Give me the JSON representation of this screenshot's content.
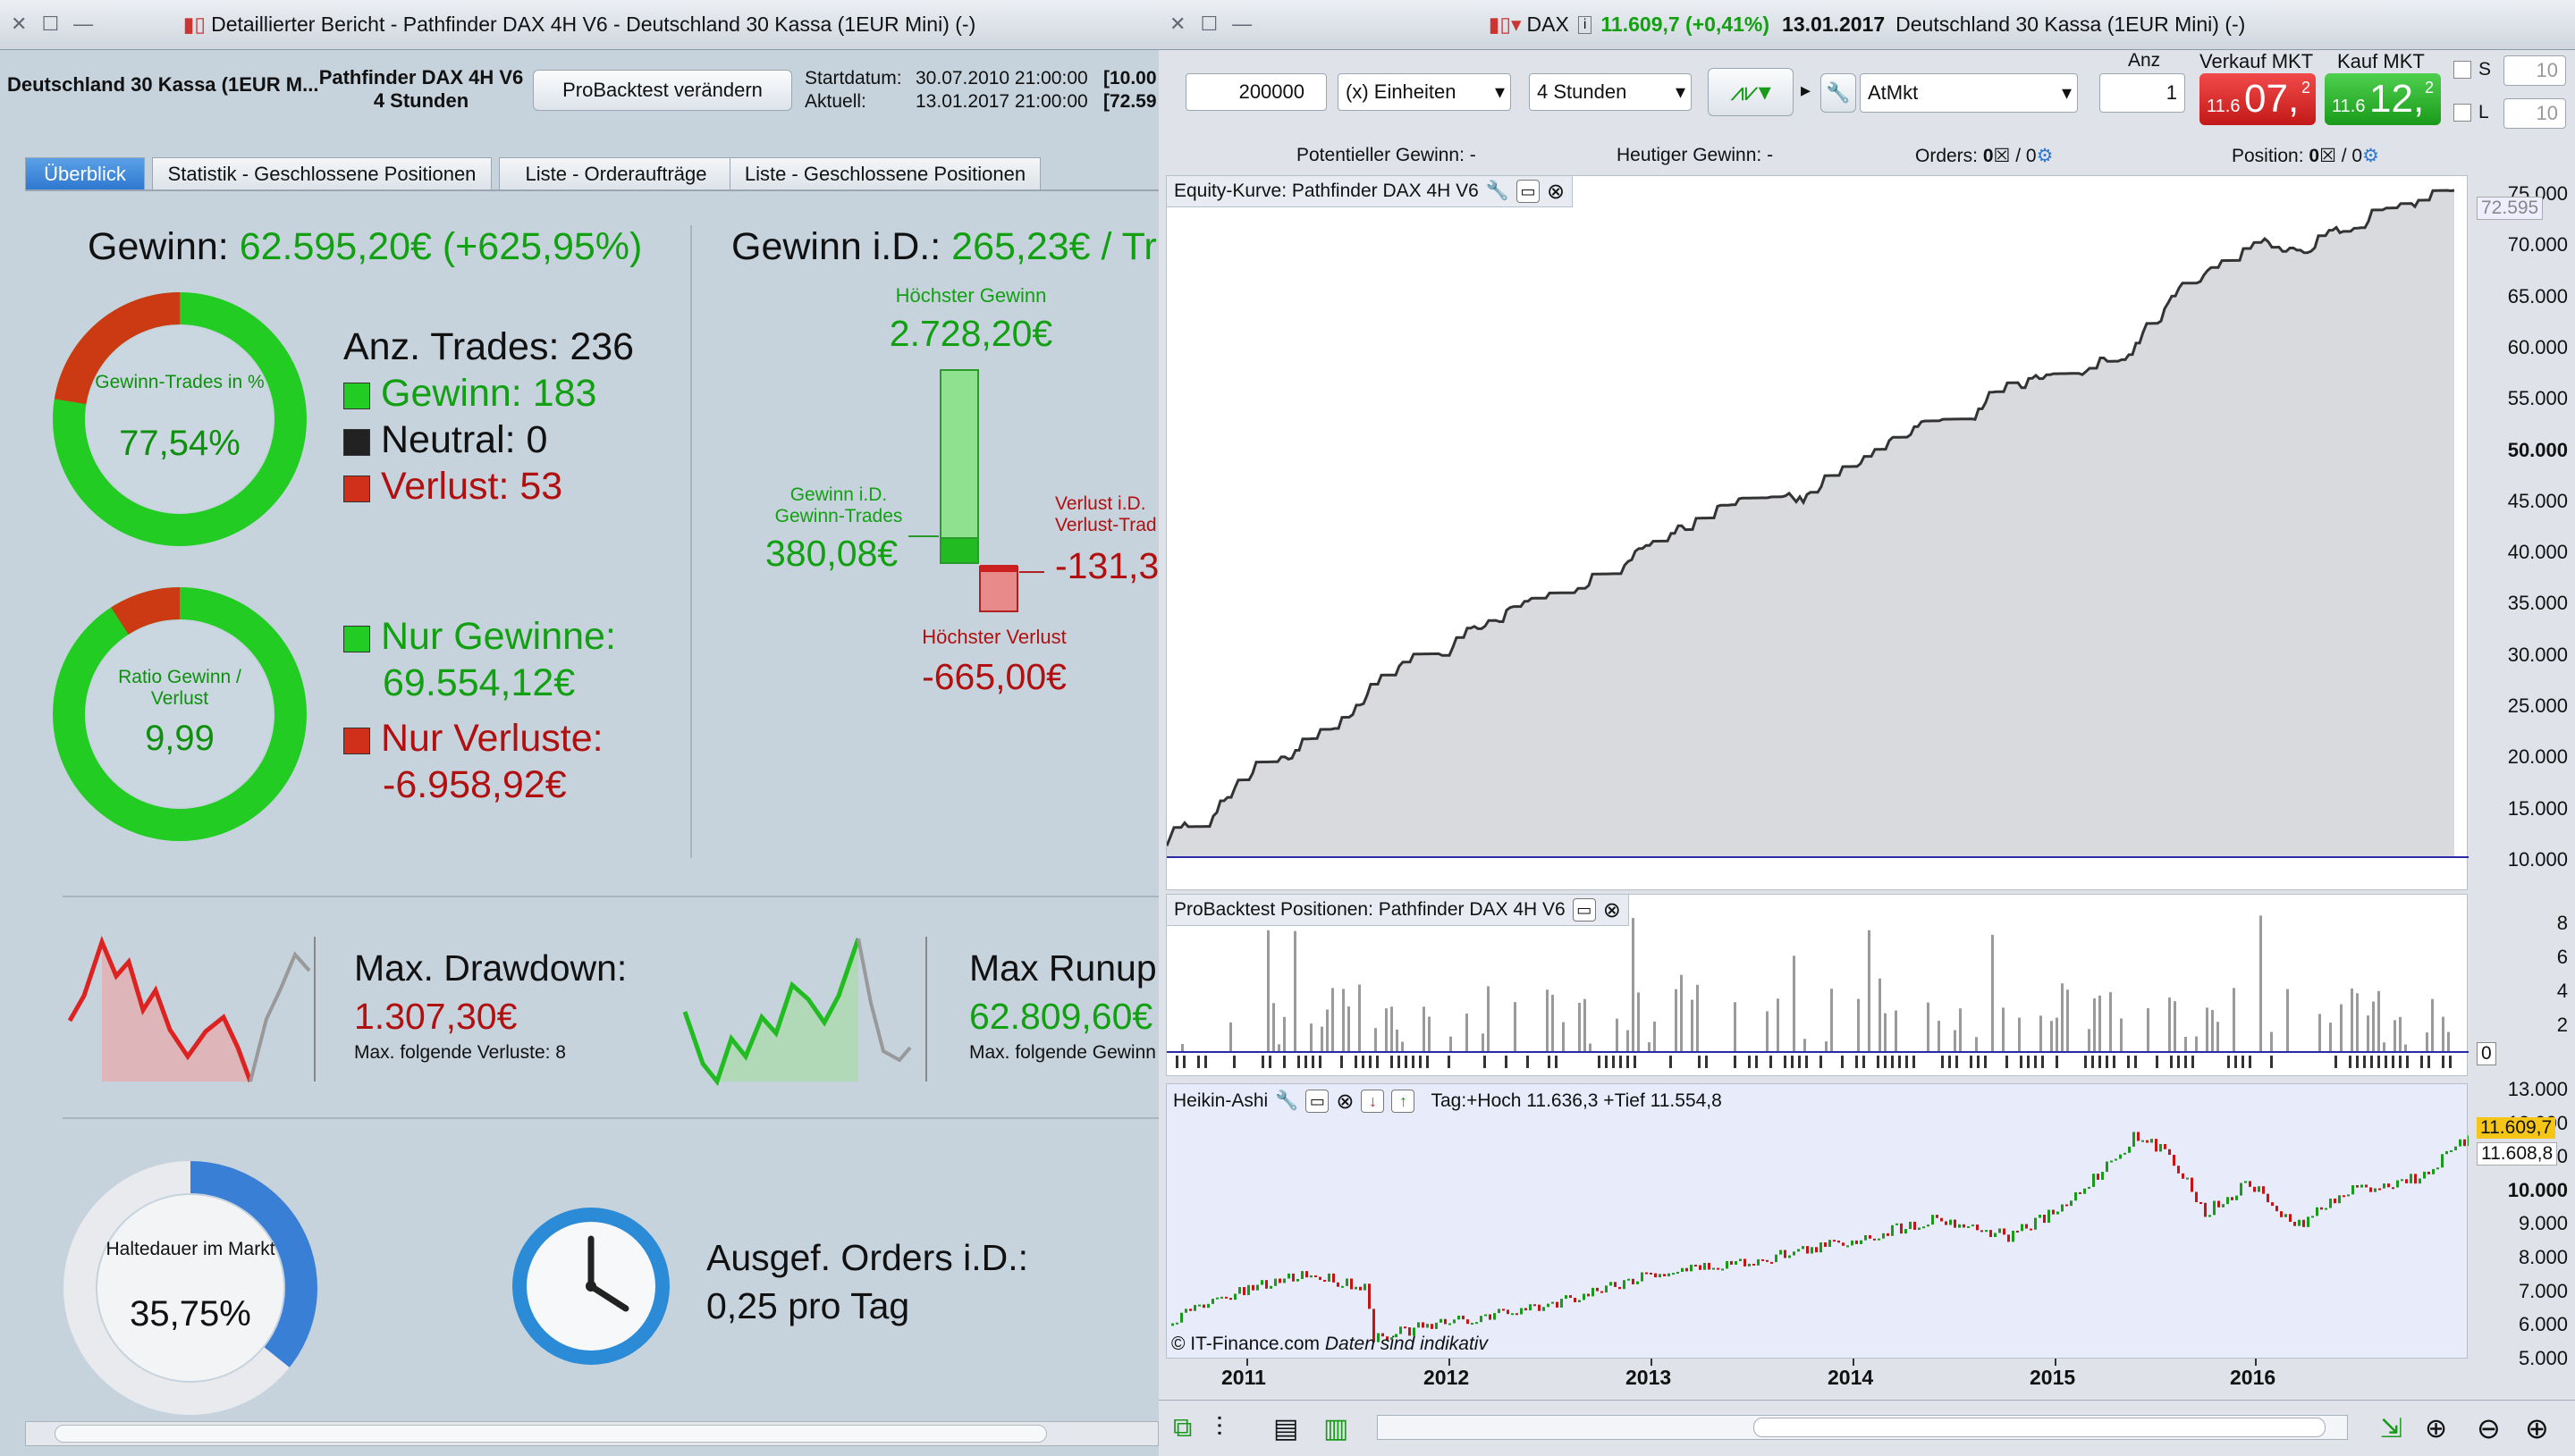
{
  "left": {
    "title": "Detaillierter Bericht - Pathfinder DAX 4H V6 - Deutschland 30 Kassa (1EUR Mini) (-)",
    "instrument": "Deutschland 30 Kassa (1EUR M...",
    "system_name": "Pathfinder DAX 4H V6",
    "system_tf": "4 Stunden",
    "modify_button": "ProBacktest verändern",
    "start_label": "Startdatum:",
    "start_value": "30.07.2010 21:00:00",
    "start_extra": "[10.00",
    "current_label": "Aktuell:",
    "current_value": "13.01.2017 21:00:00",
    "current_extra": "[72.59",
    "tabs": [
      "Überblick",
      "Statistik - Geschlossene Positionen",
      "Liste - Orderaufträge",
      "Liste - Geschlossene Positionen"
    ],
    "gain_label": "Gewinn:",
    "gain_value": "62.595,20€ (+625,95%)",
    "win_ring": {
      "label": "Gewinn-Trades in %",
      "value": "77,54%",
      "pct": 77.54
    },
    "trades_label": "Anz. Trades: 236",
    "won": "Gewinn: 183",
    "neutral": "Neutral: 0",
    "lost": "Verlust: 53",
    "ratio_ring": {
      "label": "Ratio Gewinn / Verlust",
      "value": "9,99",
      "pct": 90.91
    },
    "only_gains_label": "Nur Gewinne:",
    "only_gains_value": "69.554,12€",
    "only_losses_label": "Nur Verluste:",
    "only_losses_value": "-6.958,92€",
    "gid_label": "Gewinn i.D.:",
    "gid_value": "265,23€ / Tr",
    "highest_gain_label": "Höchster Gewinn",
    "highest_gain_value": "2.728,20€",
    "avg_win_label": "Gewinn i.D. Gewinn-Trades",
    "avg_win_value": "380,08€",
    "avg_loss_label": "Verlust i.D. Verlust-Trad",
    "avg_loss_value": "-131,3",
    "highest_loss_label": "Höchster Verlust",
    "highest_loss_value": "-665,00€",
    "drawdown_label": "Max. Drawdown:",
    "drawdown_value": "1.307,30€",
    "drawdown_sub": "Max. folgende Verluste: 8",
    "runup_label": "Max Runup",
    "runup_value": "62.809,60€",
    "runup_sub": "Max. folgende Gewinn",
    "hold_ring": {
      "label": "Haltedauer im Markt",
      "value": "35,75%",
      "pct": 35.75
    },
    "orders_label": "Ausgef. Orders i.D.:",
    "orders_value": "0,25 pro Tag"
  },
  "right": {
    "symbol": "DAX",
    "price": "11.609,7 (+0,41%)",
    "date": "13.01.2017",
    "instrument": "Deutschland 30 Kassa (1EUR Mini) (-)",
    "qty": "200000",
    "units": "(x) Einheiten",
    "timeframe": "4 Stunden",
    "order_type": "AtMkt",
    "anz_label": "Anz",
    "anz_value": "1",
    "sell_label": "Verkauf MKT",
    "sell_small": "11.6",
    "sell_big": "07,",
    "sell_sup": "2",
    "buy_label": "Kauf MKT",
    "buy_small": "11.6",
    "buy_big": "12,",
    "buy_sup": "2",
    "s_label": "S",
    "s_value": "10",
    "l_label": "L",
    "l_value": "10",
    "potential_label": "Potentieller Gewinn: -",
    "today_label": "Heutiger Gewinn: -",
    "orders_label": "Orders:",
    "orders_v1": "0",
    "orders_v2": "/ 0",
    "position_label": "Position:",
    "position_v1": "0",
    "position_v2": "/ 0",
    "equity_title": "Equity-Kurve: Pathfinder DAX 4H V6",
    "equity_last": "72.595",
    "positions_title": "ProBacktest Positionen: Pathfinder DAX 4H V6",
    "positions_zero": "0",
    "ha_title": "Heikin-Ashi",
    "ha_info": "Tag:+Hoch 11.636,3 +Tief 11.554,8",
    "ha_last": "11.609,7",
    "ha_last2": "11.608,8",
    "credit": "© IT-Finance.com",
    "credit2": "Daten sind indikativ",
    "years": [
      "2011",
      "2012",
      "2013",
      "2014",
      "2015",
      "2016"
    ],
    "equity_ticks": [
      "75.000",
      "70.000",
      "65.000",
      "60.000",
      "55.000",
      "50.000",
      "45.000",
      "40.000",
      "35.000",
      "30.000",
      "25.000",
      "20.000",
      "15.000",
      "10.000"
    ],
    "pos_ticks": [
      "8",
      "6",
      "4",
      "2"
    ],
    "ha_ticks": [
      "13.000",
      "12.000",
      "11.000",
      "10.000",
      "9.000",
      "8.000",
      "7.000",
      "6.000",
      "5.000"
    ],
    "colors": {
      "green": "#12a012",
      "red": "#c41414",
      "accent": "#2f78d0",
      "bg": "#dfe3e9"
    }
  }
}
